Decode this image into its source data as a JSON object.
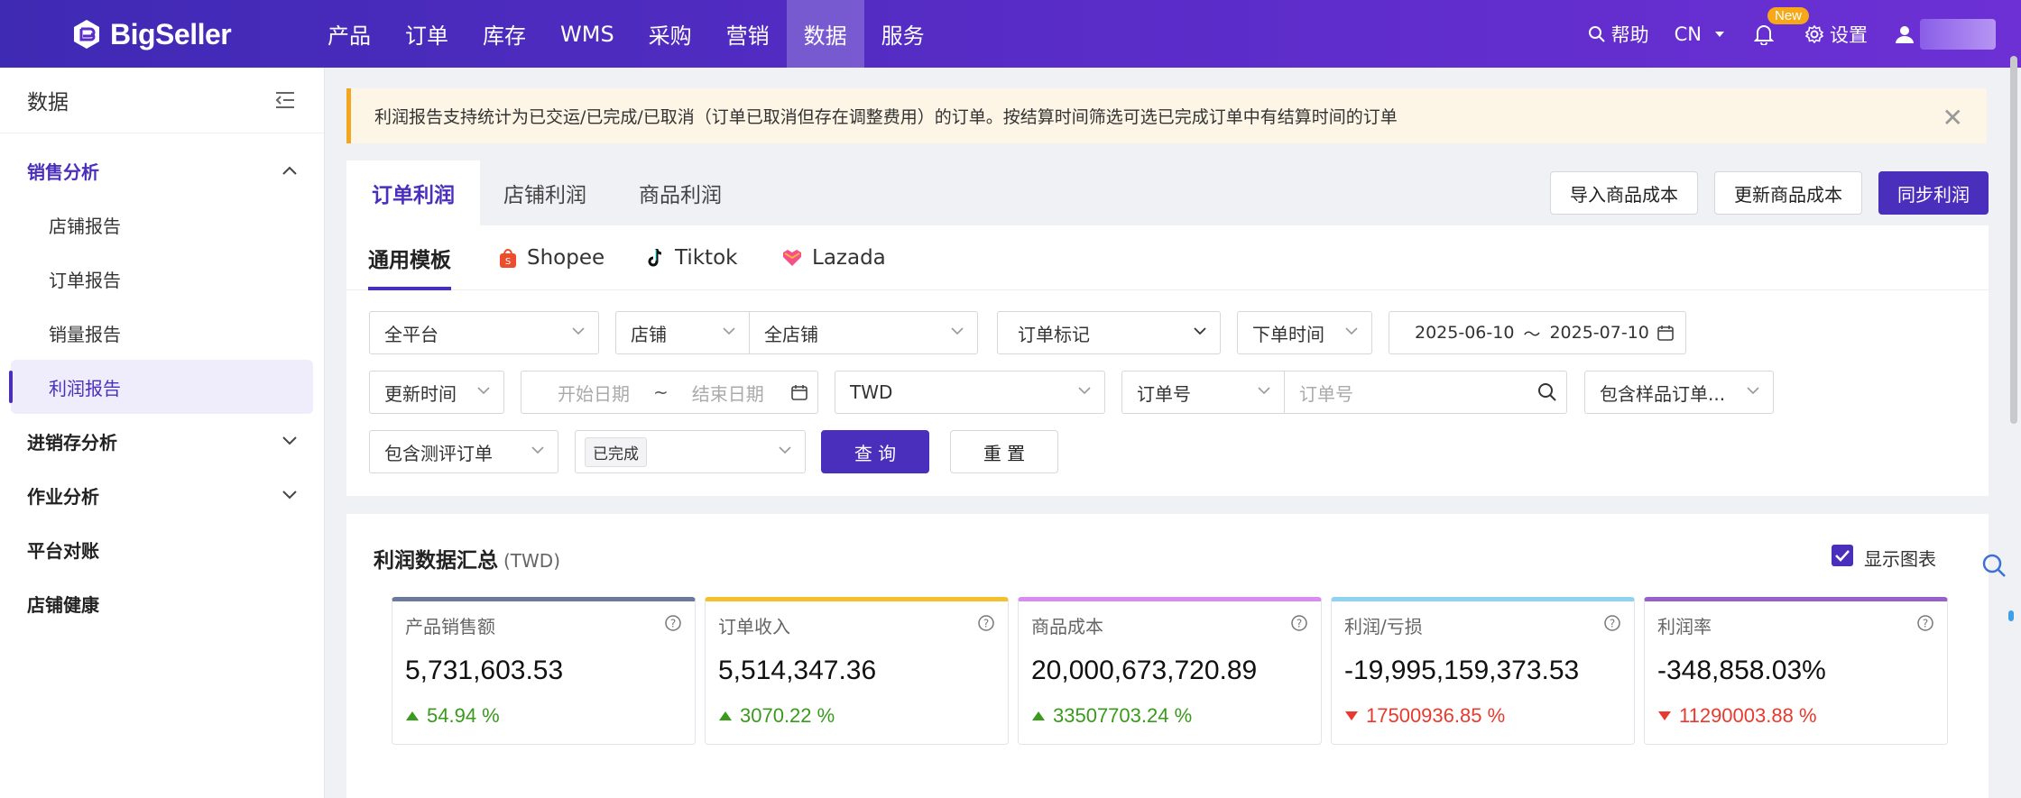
{
  "brand": {
    "name": "BigSeller"
  },
  "nav": {
    "items": [
      "产品",
      "订单",
      "库存",
      "WMS",
      "采购",
      "营销",
      "数据",
      "服务"
    ],
    "active_index": 6
  },
  "header_tools": {
    "help": "帮助",
    "lang": "CN",
    "new_badge": "New",
    "settings": "设置"
  },
  "sidebar": {
    "title": "数据",
    "groups": [
      {
        "label": "销售分析",
        "expanded": true,
        "items": [
          "店铺报告",
          "订单报告",
          "销量报告",
          "利润报告"
        ],
        "active_item": "利润报告"
      },
      {
        "label": "进销存分析",
        "expanded": false
      },
      {
        "label": "作业分析",
        "expanded": false
      },
      {
        "label": "平台对账"
      },
      {
        "label": "店铺健康"
      }
    ]
  },
  "notice": {
    "text": "利润报告支持统计为已交运/已完成/已取消（订单已取消但存在调整费用）的订单。按结算时间筛选可选已完成订单中有结算时间的订单"
  },
  "tabs": {
    "items": [
      "订单利润",
      "店铺利润",
      "商品利润"
    ],
    "active": "订单利润"
  },
  "actions": {
    "import_cost": "导入商品成本",
    "update_cost": "更新商品成本",
    "sync_profit": "同步利润"
  },
  "subtabs": {
    "items": [
      "通用模板",
      "Shopee",
      "Tiktok",
      "Lazada"
    ],
    "active": "通用模板"
  },
  "filters": {
    "platform": "全平台",
    "store_type": "店铺",
    "store": "全店铺",
    "order_mark": "订单标记",
    "date_type": "下单时间",
    "date_start": "2025-06-10",
    "date_sep": "～",
    "date_end": "2025-07-10",
    "update_time": "更新时间",
    "start_placeholder": "开始日期",
    "range_sep": "~",
    "end_placeholder": "结束日期",
    "currency": "TWD",
    "order_no_type": "订单号",
    "order_no_placeholder": "订单号",
    "include_sample": "包含样品订单...",
    "include_review": "包含测评订单",
    "status_tag": "已完成",
    "query_btn": "查 询",
    "reset_btn": "重 置"
  },
  "summary": {
    "title": "利润数据汇总",
    "unit": "(TWD)",
    "show_chart": "显示图表",
    "show_chart_checked": true,
    "metrics": [
      {
        "label": "产品销售额",
        "value": "5,731,603.53",
        "change": "54.94 %",
        "direction": "up",
        "color": "#6b7a99"
      },
      {
        "label": "订单收入",
        "value": "5,514,347.36",
        "change": "3070.22 %",
        "direction": "up",
        "color": "#f5c02b"
      },
      {
        "label": "商品成本",
        "value": "20,000,673,720.89",
        "change": "33507703.24 %",
        "direction": "up",
        "color": "#d88bf0"
      },
      {
        "label": "利润/亏损",
        "value": "-19,995,159,373.53",
        "change": "17500936.85 %",
        "direction": "down",
        "color": "#8fd3f2"
      },
      {
        "label": "利润率",
        "value": "-348,858.03%",
        "change": "11290003.88 %",
        "direction": "down",
        "color": "#9860c9"
      }
    ]
  }
}
